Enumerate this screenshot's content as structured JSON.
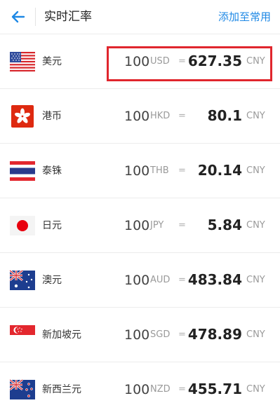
{
  "header": {
    "back_icon": "arrow-left-icon",
    "title": "实时汇率",
    "action_label": "添加至常用",
    "accent_color": "#1e88e5"
  },
  "highlight_color": "#e0262d",
  "rates": [
    {
      "name": "美元",
      "amount": "100",
      "code": "USD",
      "eq": "=",
      "rate": "627.35",
      "target": "CNY",
      "flag": "us-flag-icon"
    },
    {
      "name": "港币",
      "amount": "100",
      "code": "HKD",
      "eq": "=",
      "rate": "80.1",
      "target": "CNY",
      "flag": "hk-flag-icon"
    },
    {
      "name": "泰铢",
      "amount": "100",
      "code": "THB",
      "eq": "=",
      "rate": "20.14",
      "target": "CNY",
      "flag": "th-flag-icon"
    },
    {
      "name": "日元",
      "amount": "100",
      "code": "JPY",
      "eq": "=",
      "rate": "5.84",
      "target": "CNY",
      "flag": "jp-flag-icon"
    },
    {
      "name": "澳元",
      "amount": "100",
      "code": "AUD",
      "eq": "=",
      "rate": "483.84",
      "target": "CNY",
      "flag": "au-flag-icon"
    },
    {
      "name": "新加坡元",
      "amount": "100",
      "code": "SGD",
      "eq": "=",
      "rate": "478.89",
      "target": "CNY",
      "flag": "sg-flag-icon"
    },
    {
      "name": "新西兰元",
      "amount": "100",
      "code": "NZD",
      "eq": "=",
      "rate": "455.71",
      "target": "CNY",
      "flag": "nz-flag-icon"
    }
  ]
}
